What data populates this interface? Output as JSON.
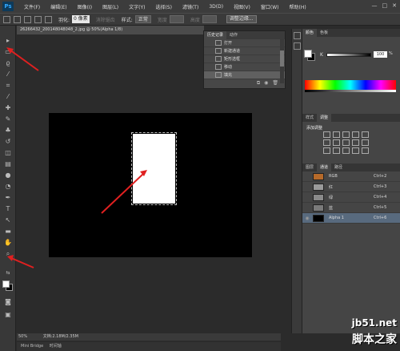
{
  "menubar": {
    "app": "Ps",
    "items": [
      "文件(F)",
      "编辑(E)",
      "图像(I)",
      "图层(L)",
      "文字(Y)",
      "选择(S)",
      "滤镜(T)",
      "3D(D)",
      "视图(V)",
      "窗口(W)",
      "帮助(H)"
    ],
    "window_controls": [
      "—",
      "□",
      "✕"
    ]
  },
  "options": {
    "feather_label": "羽化:",
    "feather_value": "0 像素",
    "antialias_label": "消除锯齿",
    "style_label": "样式:",
    "style_value": "正常",
    "width_label": "宽度",
    "height_label": "高度",
    "refine_button": "调整边缘..."
  },
  "document": {
    "tab_title": "26266432_200148048048_2.jpg @ 50%(Alpha 1/8)",
    "zoom": "50%",
    "doc_info": "文档:2.18M/2.35M"
  },
  "bridge": {
    "items": [
      "Mini Bridge",
      "时间轴"
    ]
  },
  "history": {
    "tabs": [
      "历史记录",
      "动作"
    ],
    "rows": [
      {
        "label": "打开"
      },
      {
        "label": "新建通道"
      },
      {
        "label": "矩形选框"
      },
      {
        "label": "移动"
      },
      {
        "label": "填充"
      }
    ]
  },
  "color_panel": {
    "tabs": [
      "颜色",
      "色板"
    ],
    "channel": "K",
    "value": "100",
    "unit": "%"
  },
  "adjustments": {
    "tabs": [
      "样式",
      "调整"
    ],
    "title": "添加调整"
  },
  "channels": {
    "tabs": [
      "图层",
      "通道",
      "路径"
    ],
    "rows": [
      {
        "name": "RGB",
        "shortcut": "Ctrl+2",
        "color": "#b66a2a"
      },
      {
        "name": "红",
        "shortcut": "Ctrl+3",
        "color": "#9a9a9a"
      },
      {
        "name": "绿",
        "shortcut": "Ctrl+4",
        "color": "#8a8a8a"
      },
      {
        "name": "蓝",
        "shortcut": "Ctrl+5",
        "color": "#7a7a7a"
      },
      {
        "name": "Alpha 1",
        "shortcut": "Ctrl+6",
        "color": "#000000"
      }
    ]
  },
  "watermark": {
    "site": "jb51.net",
    "text": "脚本之家"
  },
  "colors": {
    "annotation_arrow": "#e02020",
    "selected_row": "#586a7e"
  }
}
